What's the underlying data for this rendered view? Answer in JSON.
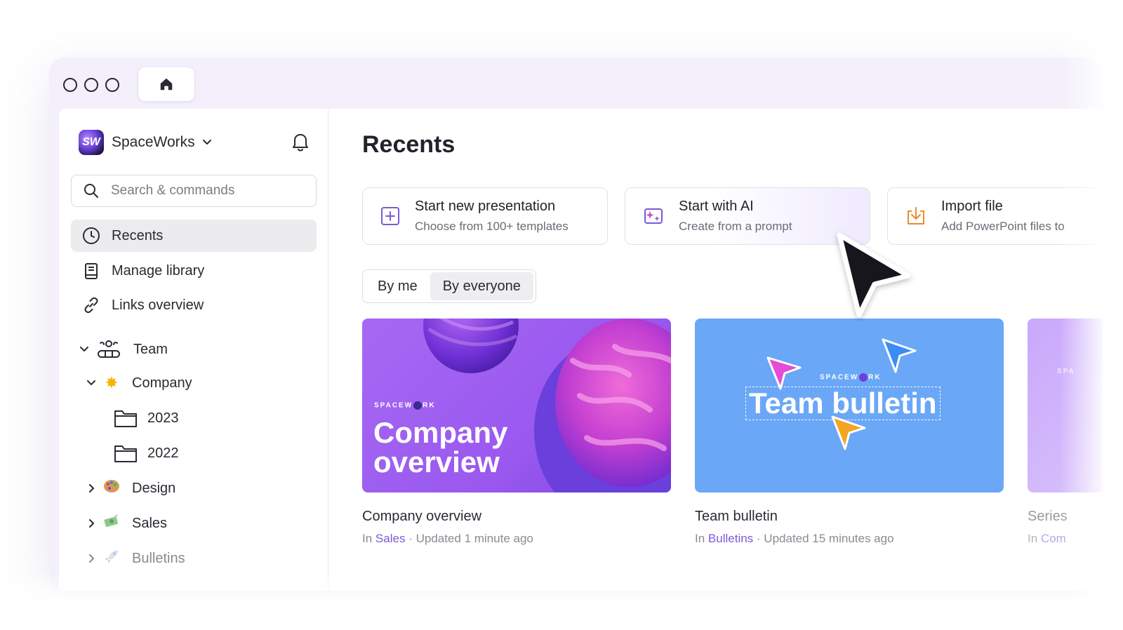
{
  "workspace": {
    "logo_text": "SW",
    "name": "SpaceWorks"
  },
  "search": {
    "placeholder": "Search & commands"
  },
  "nav": [
    {
      "label": "Recents",
      "icon": "clock-icon",
      "active": true
    },
    {
      "label": "Manage library",
      "icon": "book-icon"
    },
    {
      "label": "Links overview",
      "icon": "link-icon"
    }
  ],
  "tree": {
    "team": {
      "label": "Team",
      "icon": "team-icon"
    },
    "company": {
      "label": "Company",
      "icon": "sparkle-emoji"
    },
    "folder_2023": {
      "label": "2023",
      "icon": "folder-icon"
    },
    "folder_2022": {
      "label": "2022",
      "icon": "folder-icon"
    },
    "design": {
      "label": "Design",
      "icon": "palette-emoji"
    },
    "sales": {
      "label": "Sales",
      "icon": "money-emoji"
    },
    "bulletins": {
      "label": "Bulletins",
      "icon": "rocket-emoji"
    }
  },
  "main": {
    "title": "Recents",
    "actions": [
      {
        "title": "Start new presentation",
        "subtitle": "Choose from 100+ templates",
        "icon": "plus-square-icon"
      },
      {
        "title": "Start with AI",
        "subtitle": "Create from a prompt",
        "icon": "ai-sparkle-icon"
      },
      {
        "title": "Import file",
        "subtitle": "Add PowerPoint files to",
        "icon": "import-icon"
      }
    ],
    "filter": {
      "by_me": "By me",
      "by_everyone": "By everyone",
      "selected": "By everyone"
    },
    "cards": [
      {
        "title": "Company overview",
        "in_label": "In",
        "folder": "Sales",
        "updated": "· Updated 1 minute ago",
        "thumb_brand": "SPACEW",
        "thumb_brand_2": "RK",
        "thumb_line1": "Company",
        "thumb_line2": "overview"
      },
      {
        "title": "Team bulletin",
        "in_label": "In",
        "folder": "Bulletins",
        "updated": "· Updated 15 minutes ago",
        "thumb_brand": "SPACEW",
        "thumb_brand_2": "RK",
        "thumb_line1": "Team bulletin"
      },
      {
        "title": "Series",
        "in_label": "In",
        "folder": "Com",
        "thumb_brand": "SPA"
      }
    ]
  },
  "colors": {
    "accent": "#7b5ad6",
    "purple_thumb": "#9a58ef",
    "blue_thumb": "#6aa7f7"
  }
}
